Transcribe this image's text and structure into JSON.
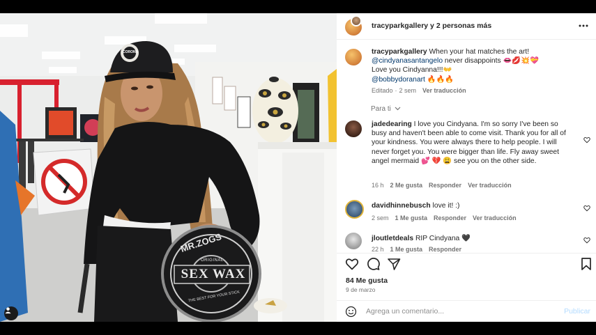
{
  "header": {
    "username": "tracyparkgallery",
    "others": " y 2 personas más"
  },
  "caption": {
    "username": "tracyparkgallery",
    "line1": " When your hat matches the art!",
    "mention1": "@cindyanasantangelo",
    "line2": " never disappoints 👄💋💥💝",
    "line3": "Love you Cindyanna!!!👐",
    "mention2": "@bobbydoranart",
    "line4": " 🔥🔥🔥",
    "edited": "Editado",
    "time": "2 sem",
    "translate": "Ver traducción"
  },
  "sort_label": "Para ti",
  "comments": [
    {
      "username": "jadedearing",
      "text": " I love you Cindyana. I'm so sorry I've been so busy and haven't been able to come visit. Thank you for all of your kindness. You were always there to help people. I will never forget you. You were bigger than life. Fly away sweet angel mermaid 💕 💔 😩 see you on the other side.",
      "time": "16 h",
      "likes": "2 Me gusta",
      "reply": "Responder",
      "translate": "Ver traducción"
    },
    {
      "username": "davidhinnebusch",
      "text": " love it! :)",
      "time": "2 sem",
      "likes": "1 Me gusta",
      "reply": "Responder",
      "translate": "Ver traducción"
    },
    {
      "username": "jloutletdeals",
      "text": " RIP Cindyana 🖤",
      "time": "22 h",
      "likes": "1 Me gusta",
      "reply": "Responder"
    }
  ],
  "likes_count": "84 Me gusta",
  "post_date": "9 de marzo",
  "comment_box": {
    "placeholder": "Agrega un comentario...",
    "publish": "Publicar"
  },
  "photo": {
    "hat_text": "CORONA",
    "sign_brand": "MR.ZOGS",
    "sign_product": "SEX WAX",
    "sign_tagline": "THE BEST FOR YOUR STICK",
    "sign_top": "ORIGINAL"
  },
  "colors": {
    "link": "#00376b",
    "muted": "#737373",
    "publish_disabled": "#b3dbff"
  }
}
